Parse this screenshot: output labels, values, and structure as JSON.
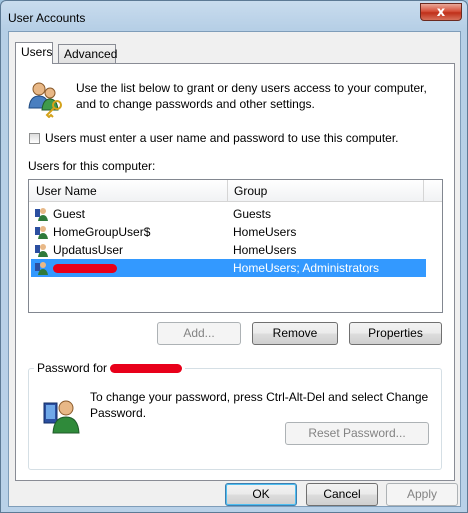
{
  "window": {
    "title": "User Accounts",
    "close_symbol": "x"
  },
  "tabs": [
    {
      "label": "Users"
    },
    {
      "label": "Advanced"
    }
  ],
  "intro": {
    "text": "Use the list below to grant or deny users access to your computer, and to change passwords and other settings."
  },
  "checkbox": {
    "label": "Users must enter a user name and password to use this computer.",
    "checked": false
  },
  "list": {
    "label": "Users for this computer:",
    "columns": [
      "User Name",
      "Group"
    ],
    "rows": [
      {
        "name": "Guest",
        "group": "Guests"
      },
      {
        "name": "HomeGroupUser$",
        "group": "HomeUsers"
      },
      {
        "name": "UpdatusUser",
        "group": "HomeUsers"
      },
      {
        "name": "",
        "group": "HomeUsers; Administrators",
        "selected": true
      }
    ]
  },
  "list_buttons": {
    "add": "Add...",
    "remove": "Remove",
    "properties": "Properties"
  },
  "password": {
    "title": "Password for",
    "text": "To change your password, press Ctrl-Alt-Del and select Change Password.",
    "reset": "Reset Password..."
  },
  "dialog_buttons": {
    "ok": "OK",
    "cancel": "Cancel",
    "apply": "Apply"
  },
  "colors": {
    "selection": "#3399ff",
    "redaction": "#e8001a",
    "close": "#c0301a"
  }
}
